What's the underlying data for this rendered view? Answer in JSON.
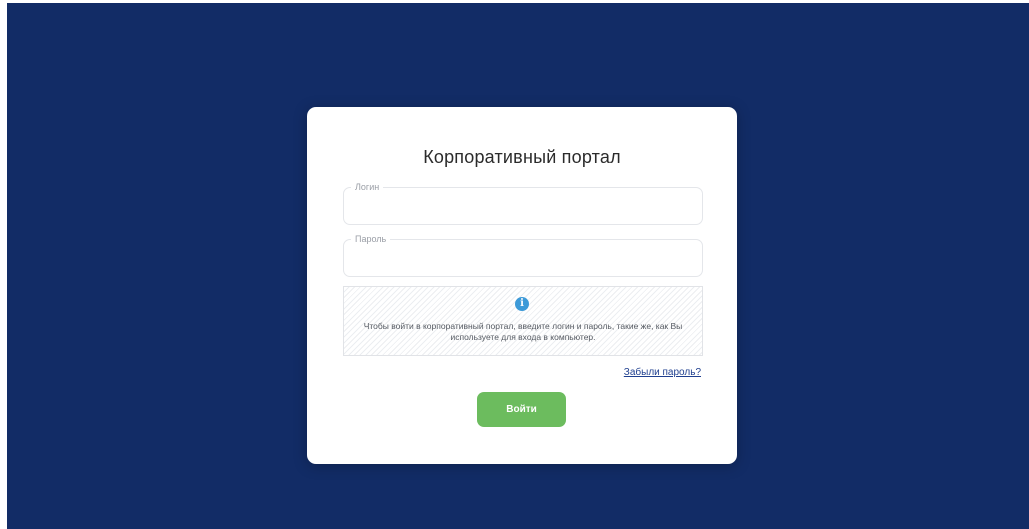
{
  "colors": {
    "background": "#122c66",
    "card": "#ffffff",
    "accent_button": "#6cbc5e",
    "info_icon": "#3d9ad8",
    "link": "#1f3f8f"
  },
  "login_card": {
    "title": "Корпоративный портал",
    "login_field": {
      "label": "Логин",
      "value": "",
      "placeholder": ""
    },
    "password_field": {
      "label": "Пароль",
      "value": "",
      "placeholder": ""
    },
    "notice": {
      "icon": "info-icon",
      "text": "Чтобы войти в корпоративный портал, введите логин и пароль, такие же, как Вы используете для входа в компьютер."
    },
    "forgot_password_link": "Забыли пароль?",
    "submit_label": "Войти"
  }
}
